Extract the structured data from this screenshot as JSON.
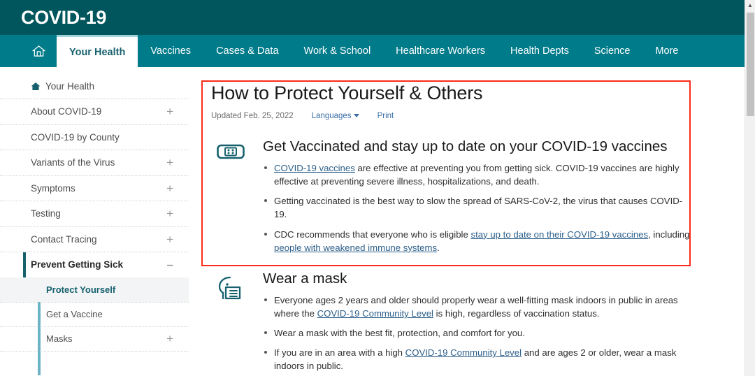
{
  "masthead": {
    "title": "COVID-19"
  },
  "nav": {
    "home_icon": "home-icon",
    "items": [
      {
        "label": "Your Health",
        "active": true
      },
      {
        "label": "Vaccines",
        "active": false
      },
      {
        "label": "Cases & Data",
        "active": false
      },
      {
        "label": "Work & School",
        "active": false
      },
      {
        "label": "Healthcare Workers",
        "active": false
      },
      {
        "label": "Health Depts",
        "active": false
      },
      {
        "label": "Science",
        "active": false
      },
      {
        "label": "More",
        "active": false
      }
    ]
  },
  "sidebar": {
    "home_label": "Your Health",
    "home_icon": "home-filled-icon",
    "items": [
      {
        "label": "About COVID-19",
        "toggle": "+"
      },
      {
        "label": "COVID-19 by County",
        "toggle": ""
      },
      {
        "label": "Variants of the Virus",
        "toggle": "+"
      },
      {
        "label": "Symptoms",
        "toggle": "+"
      },
      {
        "label": "Testing",
        "toggle": "+"
      },
      {
        "label": "Contact Tracing",
        "toggle": "+"
      },
      {
        "label": "Prevent Getting Sick",
        "toggle": "–",
        "expanded": true
      }
    ],
    "subitems": [
      {
        "label": "Protect Yourself",
        "toggle": "",
        "current": true
      },
      {
        "label": "Get a Vaccine",
        "toggle": ""
      },
      {
        "label": "Masks",
        "toggle": "+"
      }
    ]
  },
  "content": {
    "title": "How to Protect Yourself & Others",
    "updated": "Updated Feb. 25, 2022",
    "languages_label": "Languages",
    "print_label": "Print",
    "sections": [
      {
        "icon": "bandage-icon",
        "title": "Get Vaccinated and stay up to date on your COVID-19 vaccines",
        "bullets": [
          [
            {
              "t": "link",
              "text": "COVID-19 vaccines"
            },
            {
              "t": "text",
              "text": " are effective at preventing you from getting sick. COVID-19 vaccines are highly effective at preventing severe illness, hospitalizations, and death."
            }
          ],
          [
            {
              "t": "text",
              "text": "Getting vaccinated is the best way to slow the spread of SARS-CoV-2, the virus that causes COVID-19."
            }
          ],
          [
            {
              "t": "text",
              "text": "CDC recommends that everyone who is eligible "
            },
            {
              "t": "link",
              "text": "stay up to date on their COVID-19 vaccines"
            },
            {
              "t": "text",
              "text": ", including "
            },
            {
              "t": "link",
              "text": "people with weakened immune systems"
            },
            {
              "t": "text",
              "text": "."
            }
          ]
        ]
      },
      {
        "icon": "face-mask-icon",
        "title": "Wear a mask",
        "bullets": [
          [
            {
              "t": "text",
              "text": "Everyone ages 2 years and older should properly wear a well-fitting mask indoors in public in areas where the "
            },
            {
              "t": "link",
              "text": "COVID-19 Community Level"
            },
            {
              "t": "text",
              "text": " is high, regardless of vaccination status."
            }
          ],
          [
            {
              "t": "text",
              "text": "Wear a mask with the best fit, protection, and comfort for you."
            }
          ],
          [
            {
              "t": "text",
              "text": "If you are in an area with a high "
            },
            {
              "t": "link",
              "text": "COVID-19 Community Level"
            },
            {
              "t": "text",
              "text": " and are ages 2 or older, wear a mask indoors in public."
            }
          ]
        ]
      }
    ]
  },
  "annotation": {
    "color": "#fc2a18"
  },
  "scrollbar": {
    "up_arrow": "▲"
  },
  "colors": {
    "masthead_bg": "#00565c",
    "nav_bg": "#007b8a",
    "accent_teal": "#17616e",
    "link_blue": "#2c5f8a",
    "annotation_red": "#fc2a18"
  }
}
